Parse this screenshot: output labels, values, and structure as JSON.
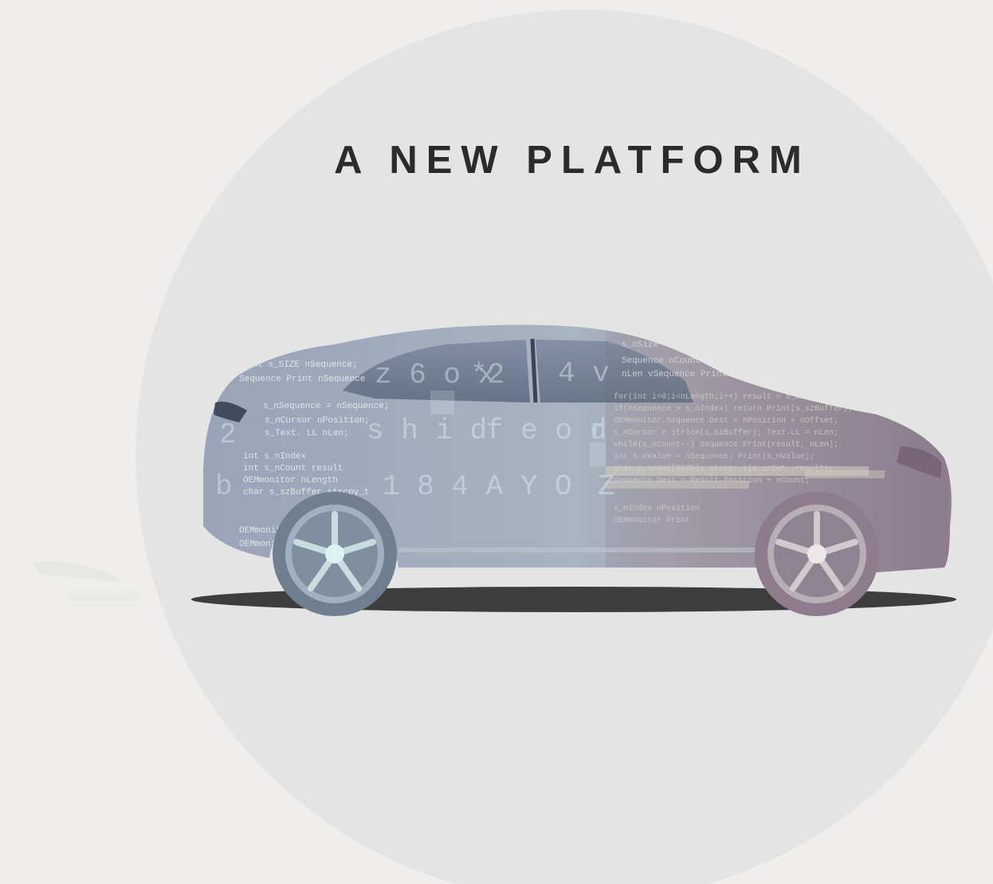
{
  "hero": {
    "title": "A NEW PLATFORM",
    "illustration_icon": "car-with-code-overlay-icon"
  },
  "colors": {
    "background": "#efeeec",
    "circle": "#e4e4e4",
    "title": "#2b2b2b",
    "car_front_tint": "#9aa8bc",
    "car_rear_tint": "#8f7f90",
    "code_glow": "#cfe6e6",
    "shadow": "#2a2a2a"
  }
}
